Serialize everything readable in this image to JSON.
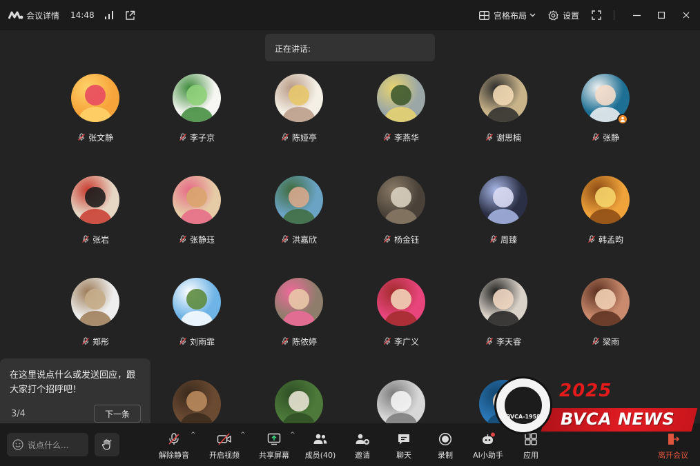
{
  "titlebar": {
    "title": "会议详情",
    "time": "14:48",
    "layout_label": "宫格布局",
    "settings_label": "设置"
  },
  "speaking": {
    "label": "正在讲话:"
  },
  "participants": [
    {
      "name": "张文静",
      "avatar": {
        "bg": "#f7a53b",
        "fg": "#e84a5f",
        "accent": "#ffd36b"
      }
    },
    {
      "name": "李子京",
      "avatar": {
        "bg": "#f6f6f2",
        "fg": "#8fd17a",
        "accent": "#3d8a3a"
      }
    },
    {
      "name": "陈娅亭",
      "avatar": {
        "bg": "#f4f0e6",
        "fg": "#e7c66a",
        "accent": "#b99a86"
      }
    },
    {
      "name": "李燕华",
      "avatar": {
        "bg": "#9aa7a6",
        "fg": "#3f5a2e",
        "accent": "#e9d46f"
      }
    },
    {
      "name": "谢思楠",
      "avatar": {
        "bg": "#c9b48a",
        "fg": "#f2d9b4",
        "accent": "#2b2b2b"
      }
    },
    {
      "name": "张静",
      "avatar": {
        "bg": "#1d6f93",
        "fg": "#f3dcc9",
        "accent": "#f4f4f4"
      },
      "host": true
    },
    {
      "name": "张岩",
      "avatar": {
        "bg": "#e6d7c5",
        "fg": "#1e1e1e",
        "accent": "#c93a2e"
      }
    },
    {
      "name": "张静珏",
      "avatar": {
        "bg": "#e5cba6",
        "fg": "#d9a56e",
        "accent": "#e76a86"
      }
    },
    {
      "name": "洪嘉欣",
      "avatar": {
        "bg": "#6aa3c4",
        "fg": "#d7a98c",
        "accent": "#3f6b3c"
      }
    },
    {
      "name": "杨金钰",
      "avatar": {
        "bg": "#4a4239",
        "fg": "#d8cfc0",
        "accent": "#8a7a66"
      }
    },
    {
      "name": "周臻",
      "avatar": {
        "bg": "#2a2f45",
        "fg": "#d9d9f2",
        "accent": "#a9b8e8"
      }
    },
    {
      "name": "韩孟昀",
      "avatar": {
        "bg": "#f0a33b",
        "fg": "#f6d46a",
        "accent": "#8a4a14"
      }
    },
    {
      "name": "郑彤",
      "avatar": {
        "bg": "#eeeeee",
        "fg": "#c7ad8a",
        "accent": "#9b7a55"
      }
    },
    {
      "name": "刘雨霏",
      "avatar": {
        "bg": "#6fb4e6",
        "fg": "#5e8c3f",
        "accent": "#ffffff"
      }
    },
    {
      "name": "陈依婷",
      "avatar": {
        "bg": "#8e7d6b",
        "fg": "#e9c8a8",
        "accent": "#f06a9a"
      }
    },
    {
      "name": "李广义",
      "avatar": {
        "bg": "#e8457c",
        "fg": "#f1d1b6",
        "accent": "#a12b2b"
      }
    },
    {
      "name": "李天睿",
      "avatar": {
        "bg": "#d9d2c8",
        "fg": "#f0d7c2",
        "accent": "#1f1f1f"
      }
    },
    {
      "name": "梁雨",
      "avatar": {
        "bg": "#c98a6d",
        "fg": "#f2cfb2",
        "accent": "#5a2f1f"
      }
    },
    {
      "name": "",
      "avatar": {
        "bg": "#f2d6d9",
        "fg": "#ffffff",
        "accent": "#e8a7b4"
      }
    },
    {
      "name": "",
      "avatar": {
        "bg": "#6b4a32",
        "fg": "#b98a5c",
        "accent": "#3a2a1c"
      }
    },
    {
      "name": "",
      "avatar": {
        "bg": "#4d7a3a",
        "fg": "#e7e2d4",
        "accent": "#2f4f25"
      }
    },
    {
      "name": "",
      "avatar": {
        "bg": "#d8d8d8",
        "fg": "#f4f4f4",
        "accent": "#7a7a7a"
      }
    },
    {
      "name": "",
      "avatar": {
        "bg": "#2a78b8",
        "fg": "#f2d8c0",
        "accent": "#14466e"
      }
    }
  ],
  "tip": {
    "text": "在这里说点什么或发送回应，跟大家打个招呼吧！",
    "page": "3/4",
    "next_label": "下一条"
  },
  "toolbar": {
    "chat_placeholder": "说点什么...",
    "unmute_label": "解除静音",
    "video_label": "开启视频",
    "share_label": "共享屏幕",
    "members_label": "成员(40)",
    "invite_label": "邀请",
    "chat_label": "聊天",
    "record_label": "录制",
    "ai_label": "AI小助手",
    "apps_label": "应用",
    "leave_label": "离开会议"
  },
  "watermark": {
    "year": "2025",
    "text": "BVCA NEWS",
    "seal_text": "BVCA-1958"
  },
  "colors": {
    "background": "#232323",
    "bar": "#1b1b1b",
    "leave": "#e0553e",
    "muted_mic": "#e04545"
  }
}
